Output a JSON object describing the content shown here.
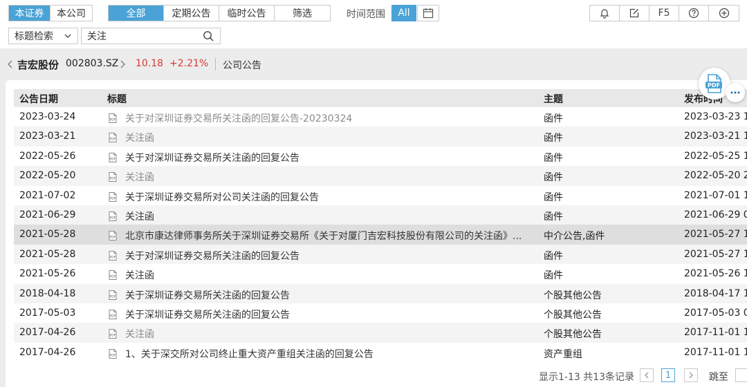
{
  "scope_tabs": [
    {
      "label": "本证券",
      "active": true
    },
    {
      "label": "本公司",
      "active": false
    }
  ],
  "category_tabs": [
    {
      "label": "全部",
      "active": true
    },
    {
      "label": "定期公告",
      "active": false
    },
    {
      "label": "临时公告",
      "active": false
    },
    {
      "label": "筛选",
      "active": false
    }
  ],
  "time_range": {
    "label": "时间范围",
    "all_label": "All"
  },
  "toolbar": {
    "f5_label": "F5"
  },
  "search": {
    "mode": "标题检索",
    "value": "关注"
  },
  "stock": {
    "name": "吉宏股份",
    "code": "002803.SZ",
    "price": "10.18",
    "change": "+2.21%",
    "section": "公司公告"
  },
  "table": {
    "columns": [
      "公告日期",
      "标题",
      "主题",
      "发布时间"
    ],
    "rows": [
      {
        "date": "2023-03-24",
        "title": "关于对深圳证券交易所关注函的回复公告-20230324",
        "visited": true,
        "topic": "函件",
        "pub": "2023-03-23 1"
      },
      {
        "date": "2023-03-21",
        "title": "关注函",
        "visited": true,
        "topic": "函件",
        "pub": "2023-03-21 1"
      },
      {
        "date": "2022-05-26",
        "title": "关于对深圳证券交易所关注函的回复公告",
        "visited": false,
        "topic": "函件",
        "pub": "2022-05-25 1"
      },
      {
        "date": "2022-05-20",
        "title": "关注函",
        "visited": true,
        "topic": "函件",
        "pub": "2022-05-20 2"
      },
      {
        "date": "2021-07-02",
        "title": "关于深圳证券交易所对公司关注函的回复公告",
        "visited": false,
        "topic": "函件",
        "pub": "2021-07-01 1"
      },
      {
        "date": "2021-06-29",
        "title": "关注函",
        "visited": false,
        "topic": "函件",
        "pub": "2021-06-29 0"
      },
      {
        "date": "2021-05-28",
        "title": "北京市康达律师事务所关于深圳证券交易所《关于对厦门吉宏科技股份有限公司的关注函》...",
        "visited": false,
        "topic": "中介公告,函件",
        "pub": "2021-05-27 1"
      },
      {
        "date": "2021-05-28",
        "title": "关于对深圳证券交易所关注函的回复公告",
        "visited": false,
        "topic": "函件",
        "pub": "2021-05-27 1"
      },
      {
        "date": "2021-05-26",
        "title": "关注函",
        "visited": false,
        "topic": "函件",
        "pub": "2021-05-26 1"
      },
      {
        "date": "2018-04-18",
        "title": "关于深圳证券交易所关注函的回复公告",
        "visited": false,
        "topic": "个股其他公告",
        "pub": "2018-04-17 1"
      },
      {
        "date": "2017-05-03",
        "title": "关于深圳证券交易所关注函的回复公告",
        "visited": false,
        "topic": "个股其他公告",
        "pub": "2017-05-03 0"
      },
      {
        "date": "2017-04-26",
        "title": "关注函",
        "visited": true,
        "topic": "个股其他公告",
        "pub": "2017-11-01 1"
      },
      {
        "date": "2017-04-26",
        "title": "1、关于深交所对公司终止重大资产重组关注函的回复公告",
        "visited": false,
        "topic": "资产重组",
        "pub": "2017-11-01 1"
      }
    ]
  },
  "pagination": {
    "info": "显示1-13 共13条记录",
    "current_page": "1",
    "jump_label": "跳至"
  },
  "colors": {
    "accent": "#4aa2d6",
    "up": "#d43b3b"
  }
}
